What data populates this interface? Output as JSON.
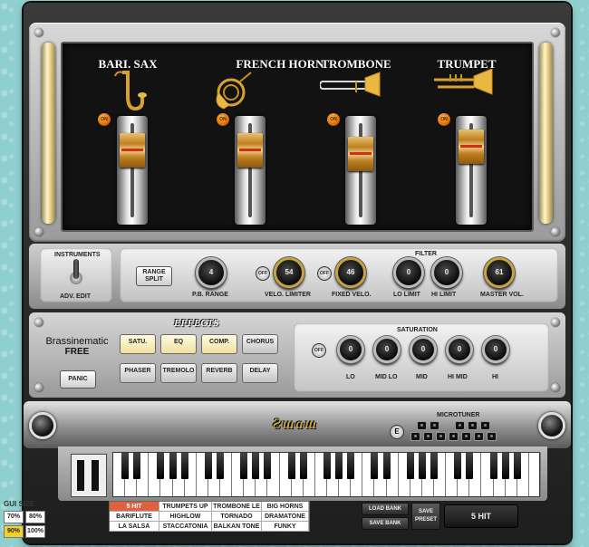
{
  "instruments": [
    {
      "name": "BARI. SAX",
      "on": "ON",
      "level": 0.8
    },
    {
      "name": "FRENCH HORN",
      "on": "ON",
      "level": 0.8
    },
    {
      "name": "TROMBONE",
      "on": "ON",
      "level": 0.75
    },
    {
      "name": "TRUMPET",
      "on": "ON",
      "level": 0.85
    }
  ],
  "instruments_panel": {
    "title": "INSTRUMENTS",
    "adv_edit": "ADV. EDIT"
  },
  "range_split": "RANGE SPLIT",
  "filter": {
    "title": "FILTER",
    "off_label": "OFF",
    "pb_range": {
      "label": "P.B. RANGE",
      "value": "4"
    },
    "velo_limiter": {
      "label": "VELO. LIMITER",
      "value": "54"
    },
    "fixed_velo": {
      "label": "FIXED VELO.",
      "value": "46"
    },
    "lo_limit": {
      "label": "LO LIMIT",
      "value": "0"
    },
    "hi_limit": {
      "label": "HI LIMIT",
      "value": "0"
    },
    "master_vol": {
      "label": "MASTER VOL.",
      "value": "61"
    }
  },
  "effects": {
    "title": "EFFECTS",
    "logo": "Brassinematic",
    "logo_sub": "FREE",
    "panic": "PANIC",
    "buttons": [
      "SATU.",
      "EQ",
      "COMP.",
      "CHORUS",
      "PHASER",
      "TREMOLO",
      "REVERB",
      "DELAY"
    ]
  },
  "saturation": {
    "title": "SATURATION",
    "off_label": "OFF",
    "knobs": [
      {
        "label": "LO",
        "value": "0"
      },
      {
        "label": "MID LO",
        "value": "0"
      },
      {
        "label": "MID",
        "value": "0"
      },
      {
        "label": "HI MID",
        "value": "0"
      },
      {
        "label": "HI",
        "value": "0"
      }
    ]
  },
  "brand": "Ƨɯɑɯ",
  "microtuner": {
    "title": "MICROTUNER",
    "knob": "E"
  },
  "presets": [
    [
      "5 HIT",
      "TRUMPETS UP",
      "TROMBONE LE",
      "BIG HORNS"
    ],
    [
      "BARIFLUTE",
      "HIGHLOW",
      "TORNADO",
      "DRAMATONE"
    ],
    [
      "LA SALSA",
      "STACCATONIA",
      "BALKAN TONE",
      "FUNKY HORNS"
    ]
  ],
  "load_bank": "LOAD BANK",
  "save_bank": "SAVE BANK",
  "save_preset": "SAVE PRESET",
  "current_preset": "5 HIT",
  "gui_size": {
    "title": "GUI SIZE",
    "options": [
      "70%",
      "80%",
      "90%",
      "100%"
    ],
    "selected": "90%"
  },
  "colors": {
    "accent": "#e07000",
    "selected_preset": "#e06040",
    "gui_selected": "#f2d030"
  }
}
